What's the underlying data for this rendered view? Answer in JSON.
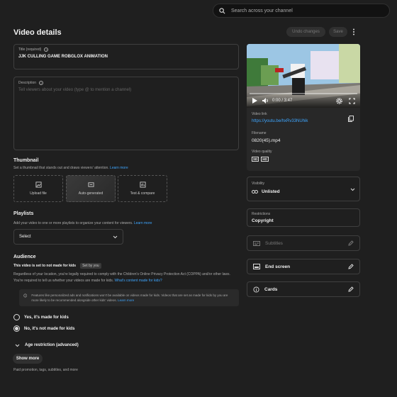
{
  "search": {
    "placeholder": "Search across your channel"
  },
  "header": {
    "title": "Video details",
    "undo_label": "Undo changes",
    "save_label": "Save"
  },
  "title_field": {
    "label": "Title (required)",
    "value": "JJK CULLING GAME ROBGLOX ANIMATION"
  },
  "description_field": {
    "label": "Description",
    "placeholder": "Tell viewers about your video (type @ to mention a channel)"
  },
  "thumbnail": {
    "heading": "Thumbnail",
    "desc": "Set a thumbnail that stands out and draws viewers' attention.",
    "learn_more": "Learn more",
    "options": [
      "Upload file",
      "Auto-generated",
      "Test & compare"
    ]
  },
  "playlists": {
    "heading": "Playlists",
    "desc": "Add your video to one or more playlists to organize your content for viewers.",
    "learn_more": "Learn more",
    "select": "Select"
  },
  "audience": {
    "heading": "Audience",
    "status": "This video is set to not made for kids",
    "set_by": "Set by you",
    "desc": "Regardless of your location, you're legally required to comply with the Children's Online Privacy Protection Act (COPPA) and/or other laws. You're required to tell us whether your videos are made for kids.",
    "desc_link": "What's content made for kids?",
    "info": "Features like personalized ads and notifications won't be available on videos made for kids. Videos that are set as made for kids by you are more likely to be recommended alongside other kids' videos.",
    "info_link": "Learn more",
    "options": [
      "Yes, it's made for kids",
      "No, it's not made for kids"
    ],
    "selected_index": 1
  },
  "age_restriction": "Age restriction (advanced)",
  "show_more": {
    "label": "Show more",
    "desc": "Paid promotion, tags, subtitles, and more"
  },
  "player": {
    "time": "0:00 / 3:47",
    "progress": 0
  },
  "video_info": {
    "link_label": "Video link",
    "link": "https://youtu.be/hxRv33NUhik",
    "filename_label": "Filename",
    "filename": "0820(45).mp4",
    "quality_label": "Video quality",
    "qualities": [
      "SD",
      "HD"
    ]
  },
  "visibility": {
    "label": "Visibility",
    "value": "Unlisted"
  },
  "restrictions": {
    "label": "Restrictions",
    "value": "Copyright"
  },
  "side_cards": [
    {
      "label": "Subtitles",
      "icon": "subtitles-icon",
      "disabled": true
    },
    {
      "label": "End screen",
      "icon": "end-screen-icon",
      "disabled": false
    },
    {
      "label": "Cards",
      "icon": "info-icon",
      "disabled": false
    }
  ],
  "colors": {
    "background": "#1f1f1f",
    "link": "#3ea6ff",
    "border": "#3f3f3f"
  }
}
